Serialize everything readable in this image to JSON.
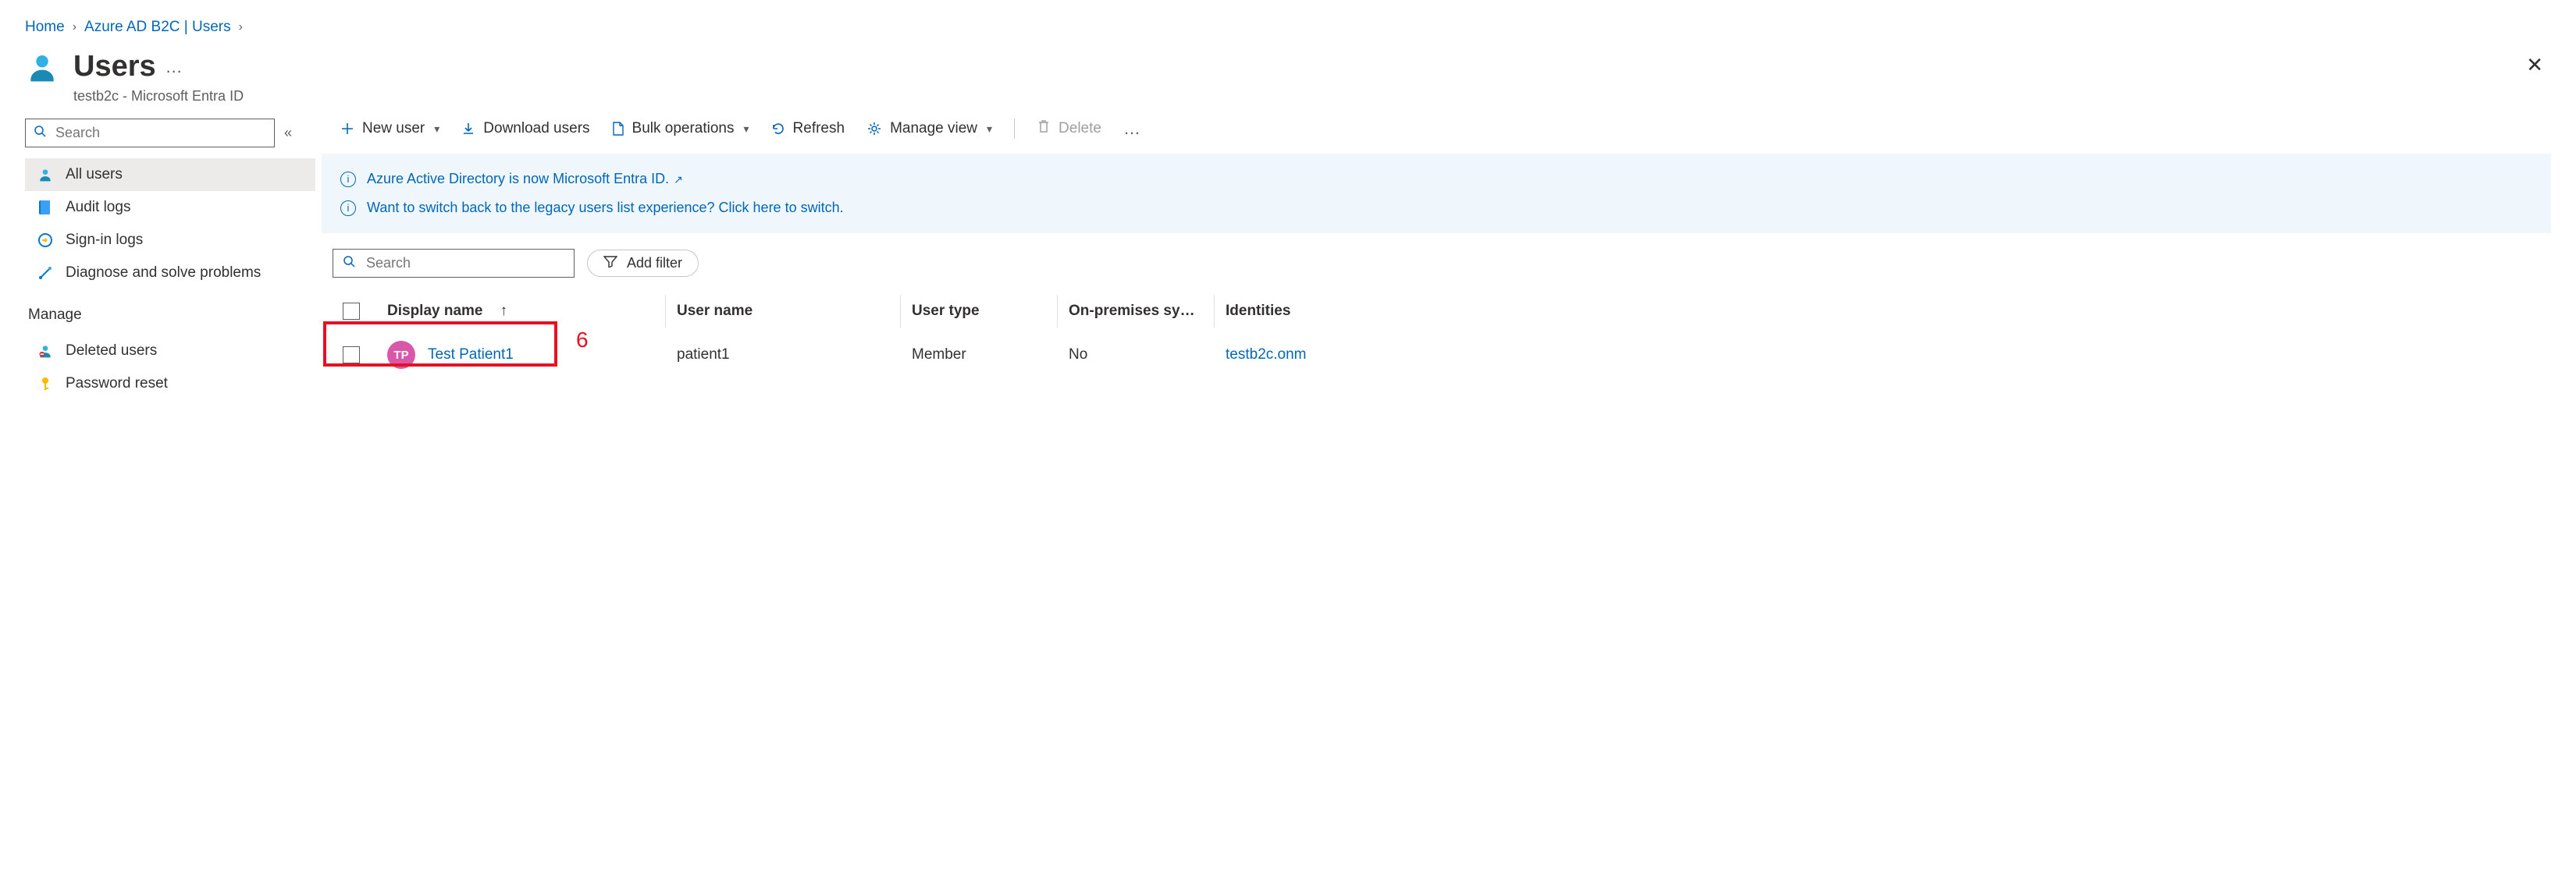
{
  "breadcrumb": {
    "home": "Home",
    "level1": "Azure AD B2C | Users"
  },
  "page": {
    "title": "Users",
    "subtitle": "testb2c - Microsoft Entra ID"
  },
  "sidebar": {
    "search_placeholder": "Search",
    "items": {
      "all_users": "All users",
      "audit_logs": "Audit logs",
      "sign_in_logs": "Sign-in logs",
      "diagnose": "Diagnose and solve problems"
    },
    "manage_label": "Manage",
    "manage": {
      "deleted_users": "Deleted users",
      "password_reset": "Password reset"
    }
  },
  "toolbar": {
    "new_user": "New user",
    "download_users": "Download users",
    "bulk_operations": "Bulk operations",
    "refresh": "Refresh",
    "manage_view": "Manage view",
    "delete": "Delete"
  },
  "banners": {
    "entra": "Azure Active Directory is now Microsoft Entra ID.",
    "legacy": "Want to switch back to the legacy users list experience? Click here to switch."
  },
  "filters": {
    "search_placeholder": "Search",
    "add_filter": "Add filter"
  },
  "table": {
    "headers": {
      "display_name": "Display name",
      "user_name": "User name",
      "user_type": "User type",
      "on_premises": "On-premises sy…",
      "identities": "Identities"
    },
    "rows": [
      {
        "initials": "TP",
        "display_name": "Test Patient1",
        "user_name": "patient1",
        "user_type": "Member",
        "on_premises": "No",
        "identities": "testb2c.onm"
      }
    ]
  },
  "callout": {
    "six": "6"
  },
  "chart_data": {
    "type": "table",
    "title": "Users",
    "columns": [
      "Display name",
      "User name",
      "User type",
      "On-premises sync",
      "Identities"
    ],
    "rows": [
      [
        "Test Patient1",
        "patient1",
        "Member",
        "No",
        "testb2c.onm"
      ]
    ]
  }
}
